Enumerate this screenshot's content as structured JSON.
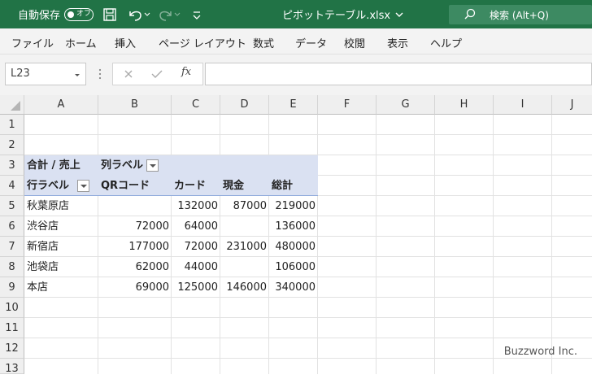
{
  "titlebar": {
    "autosave_label": "自動保存",
    "autosave_state": "オフ",
    "file_name": "ピボットテーブル.xlsx",
    "search_label": "検索 (Alt+Q)"
  },
  "menu": [
    "ファイル",
    "ホーム",
    "挿入",
    "ページ レイアウト",
    "数式",
    "データ",
    "校閲",
    "表示",
    "ヘルプ"
  ],
  "formula_bar": {
    "name_box": "L23",
    "fx_label": "fx",
    "formula": ""
  },
  "columns": [
    "A",
    "B",
    "C",
    "D",
    "E",
    "F",
    "G",
    "H",
    "I",
    "J"
  ],
  "rows": [
    "1",
    "2",
    "3",
    "4",
    "5",
    "6",
    "7",
    "8",
    "9",
    "10",
    "11",
    "12",
    "13"
  ],
  "pivot": {
    "value_header": "合計 / 売上",
    "column_labels": "列ラベル",
    "row_labels": "行ラベル",
    "col_headers": [
      "QRコード",
      "カード",
      "現金",
      "総計"
    ],
    "data_rows": [
      {
        "label": "秋葉原店",
        "values": [
          "",
          "132000",
          "87000",
          "219000"
        ]
      },
      {
        "label": "渋谷店",
        "values": [
          "72000",
          "64000",
          "",
          "136000"
        ]
      },
      {
        "label": "新宿店",
        "values": [
          "177000",
          "72000",
          "231000",
          "480000"
        ]
      },
      {
        "label": "池袋店",
        "values": [
          "62000",
          "44000",
          "",
          "106000"
        ]
      },
      {
        "label": "本店",
        "values": [
          "69000",
          "125000",
          "146000",
          "340000"
        ]
      }
    ]
  },
  "watermark": "Buzzword Inc.",
  "colors": {
    "accent": "#217346",
    "pivot_header_band": "#dae1f2"
  }
}
